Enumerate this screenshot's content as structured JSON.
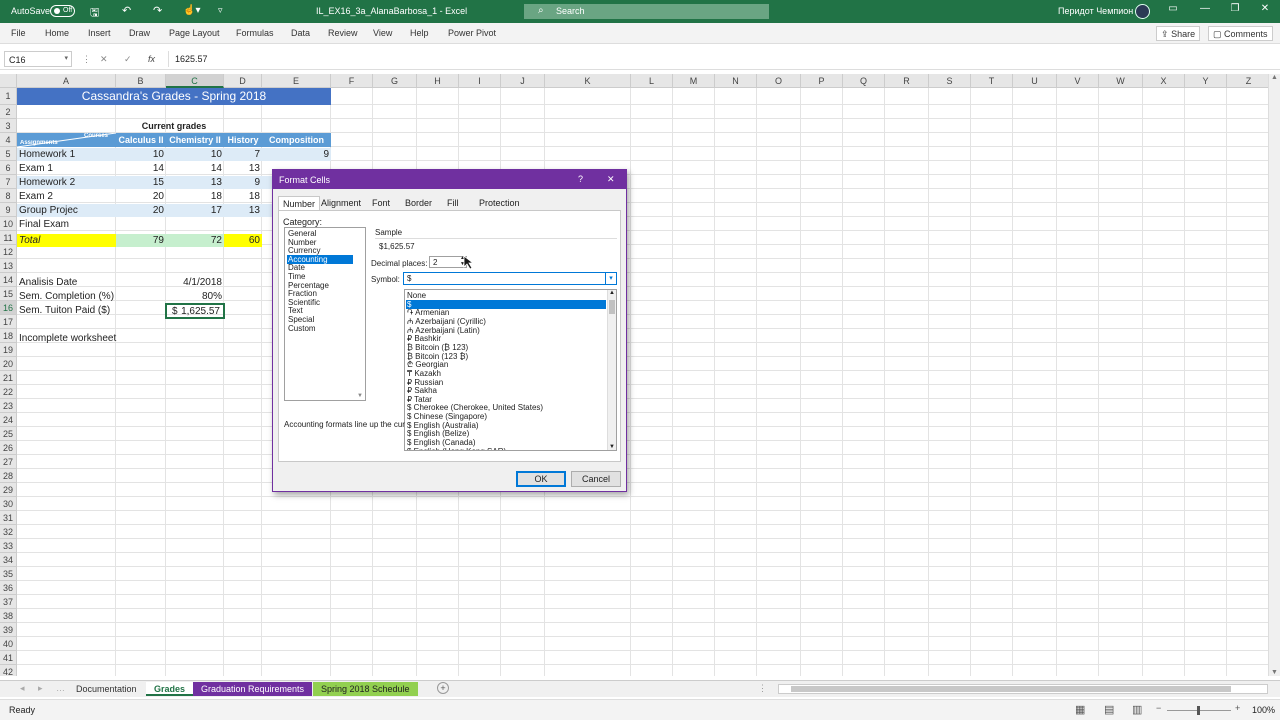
{
  "titlebar": {
    "autosave_label": "AutoSave",
    "autosave_state": "Off",
    "file_title": "IL_EX16_3a_AlanaBarbosa_1  -  Excel",
    "search_placeholder": "Search",
    "user_name": "Перидот Чемпион"
  },
  "menu": [
    "File",
    "Home",
    "Insert",
    "Draw",
    "Page Layout",
    "Formulas",
    "Data",
    "Review",
    "View",
    "Help",
    "Power Pivot"
  ],
  "share_label": "Share",
  "comments_label": "Comments",
  "formula_bar": {
    "name_box": "C16",
    "fx": "fx",
    "value": "1625.57"
  },
  "columns": [
    "A",
    "B",
    "C",
    "D",
    "E",
    "F",
    "G",
    "H",
    "I",
    "J",
    "K",
    "L",
    "M",
    "N",
    "O",
    "P",
    "Q",
    "R",
    "S",
    "T",
    "U",
    "V",
    "W",
    "X",
    "Y",
    "Z"
  ],
  "rows": [
    "1",
    "2",
    "3",
    "4",
    "5",
    "6",
    "7",
    "8",
    "9",
    "10",
    "11",
    "12",
    "13",
    "14",
    "15",
    "16",
    "17",
    "18",
    "19",
    "20",
    "21",
    "22",
    "23",
    "24",
    "25",
    "26",
    "27",
    "28",
    "29",
    "30",
    "31",
    "32",
    "33",
    "34",
    "35",
    "36",
    "37",
    "38",
    "39",
    "40",
    "41",
    "42"
  ],
  "sheet": {
    "title": "Cassandra's Grades - Spring 2018",
    "current_grades": "Current grades",
    "courses_label": "Courses",
    "assignments_label": "Assignments",
    "headers": [
      "Calculus II",
      "Chemistry II",
      "History",
      "Composition"
    ],
    "data_rows": [
      {
        "label": "Homework 1",
        "values": [
          "10",
          "10",
          "7",
          "9"
        ]
      },
      {
        "label": "Exam 1",
        "values": [
          "14",
          "14",
          "13",
          ""
        ]
      },
      {
        "label": "Homework 2",
        "values": [
          "15",
          "13",
          "9",
          ""
        ]
      },
      {
        "label": "Exam 2",
        "values": [
          "20",
          "18",
          "18",
          ""
        ]
      },
      {
        "label": "Group Projec",
        "values": [
          "20",
          "17",
          "13",
          ""
        ]
      },
      {
        "label": "Final Exam",
        "values": [
          "",
          "",
          "",
          ""
        ]
      }
    ],
    "total_label": "Total",
    "totals": [
      "79",
      "72",
      "60"
    ],
    "analysis_date_label": "Analisis Date",
    "analysis_date": "4/1/2018",
    "completion_label": "Sem. Completion (%)",
    "completion": "80%",
    "tuition_label": "Sem. Tuiton Paid ($)",
    "tuition_symbol": "$",
    "tuition_value": "1,625.57",
    "incomplete_label": "Incomplete worksheet"
  },
  "dialog": {
    "title": "Format Cells",
    "help": "?",
    "close": "✕",
    "tabs": [
      "Number",
      "Alignment",
      "Font",
      "Border",
      "Fill",
      "Protection"
    ],
    "category_label": "Category:",
    "categories": [
      "General",
      "Number",
      "Currency",
      "Accounting",
      "Date",
      "Time",
      "Percentage",
      "Fraction",
      "Scientific",
      "Text",
      "Special",
      "Custom"
    ],
    "selected_category": "Accounting",
    "sample_label": "Sample",
    "sample_value": "$1,625.57",
    "decimal_label": "Decimal places:",
    "decimal_value": "2",
    "symbol_label": "Symbol:",
    "symbol_value": "$",
    "symbols": [
      "None",
      "$",
      "֏ Armenian",
      "₼ Azerbaijani (Cyrillic)",
      "₼ Azerbaijani (Latin)",
      "₽ Bashkir",
      "₿ Bitcoin (₿ 123)",
      "₿ Bitcoin (123 ₿)",
      "₾ Georgian",
      "₸ Kazakh",
      "₽ Russian",
      "₽ Sakha",
      "₽ Tatar",
      "$ Cherokee (Cherokee, United States)",
      "$ Chinese (Singapore)",
      "$ English (Australia)",
      "$ English (Belize)",
      "$ English (Canada)",
      "$ English (Hong Kong SAR)"
    ],
    "selected_symbol": "$",
    "description": "Accounting formats line up the cur",
    "ok": "OK",
    "cancel": "Cancel"
  },
  "tabs": [
    {
      "label": "Documentation",
      "style": "normal"
    },
    {
      "label": "Grades",
      "style": "active"
    },
    {
      "label": "Graduation Requirements",
      "style": "purple"
    },
    {
      "label": "Spring 2018 Schedule",
      "style": "green"
    }
  ],
  "status": {
    "ready": "Ready",
    "zoom": "100%"
  },
  "colors": {
    "excel_green": "#217346",
    "dialog_purple": "#7030a0",
    "header_blue": "#5b9bd5",
    "title_blue": "#4472c4",
    "selection_blue": "#0078d7"
  }
}
